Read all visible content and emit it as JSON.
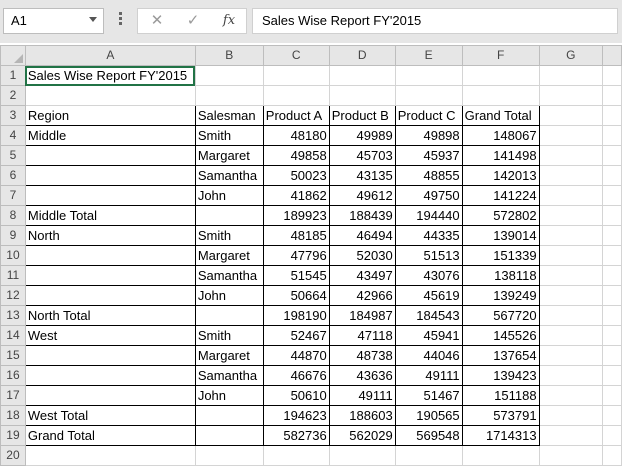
{
  "formula_bar": {
    "name_box": "A1",
    "fx_label": "fx",
    "cancel_glyph": "✕",
    "enter_glyph": "✓",
    "formula": "Sales Wise Report FY'2015"
  },
  "columns": [
    "A",
    "B",
    "C",
    "D",
    "E",
    "F",
    "G"
  ],
  "sheet": {
    "title": "Sales Wise Report FY'2015",
    "headers": [
      "Region",
      "Salesman",
      "Product A",
      "Product B",
      "Product C",
      "Grand Total"
    ],
    "rows": [
      [
        "Middle",
        "Smith",
        "48180",
        "49989",
        "49898",
        "148067"
      ],
      [
        "",
        "Margaret",
        "49858",
        "45703",
        "45937",
        "141498"
      ],
      [
        "",
        "Samantha",
        "50023",
        "43135",
        "48855",
        "142013"
      ],
      [
        "",
        "John",
        "41862",
        "49612",
        "49750",
        "141224"
      ],
      [
        "Middle Total",
        "",
        "189923",
        "188439",
        "194440",
        "572802"
      ],
      [
        "North",
        "Smith",
        "48185",
        "46494",
        "44335",
        "139014"
      ],
      [
        "",
        "Margaret",
        "47796",
        "52030",
        "51513",
        "151339"
      ],
      [
        "",
        "Samantha",
        "51545",
        "43497",
        "43076",
        "138118"
      ],
      [
        "",
        "John",
        "50664",
        "42966",
        "45619",
        "139249"
      ],
      [
        "North Total",
        "",
        "198190",
        "184987",
        "184543",
        "567720"
      ],
      [
        "West",
        "Smith",
        "52467",
        "47118",
        "45941",
        "145526"
      ],
      [
        "",
        "Margaret",
        "44870",
        "48738",
        "44046",
        "137654"
      ],
      [
        "",
        "Samantha",
        "46676",
        "43636",
        "49111",
        "139423"
      ],
      [
        "",
        "John",
        "50610",
        "49111",
        "51467",
        "151188"
      ],
      [
        "West Total",
        "",
        "194623",
        "188603",
        "190565",
        "573791"
      ],
      [
        "Grand Total",
        "",
        "582736",
        "562029",
        "569548",
        "1714313"
      ]
    ]
  }
}
